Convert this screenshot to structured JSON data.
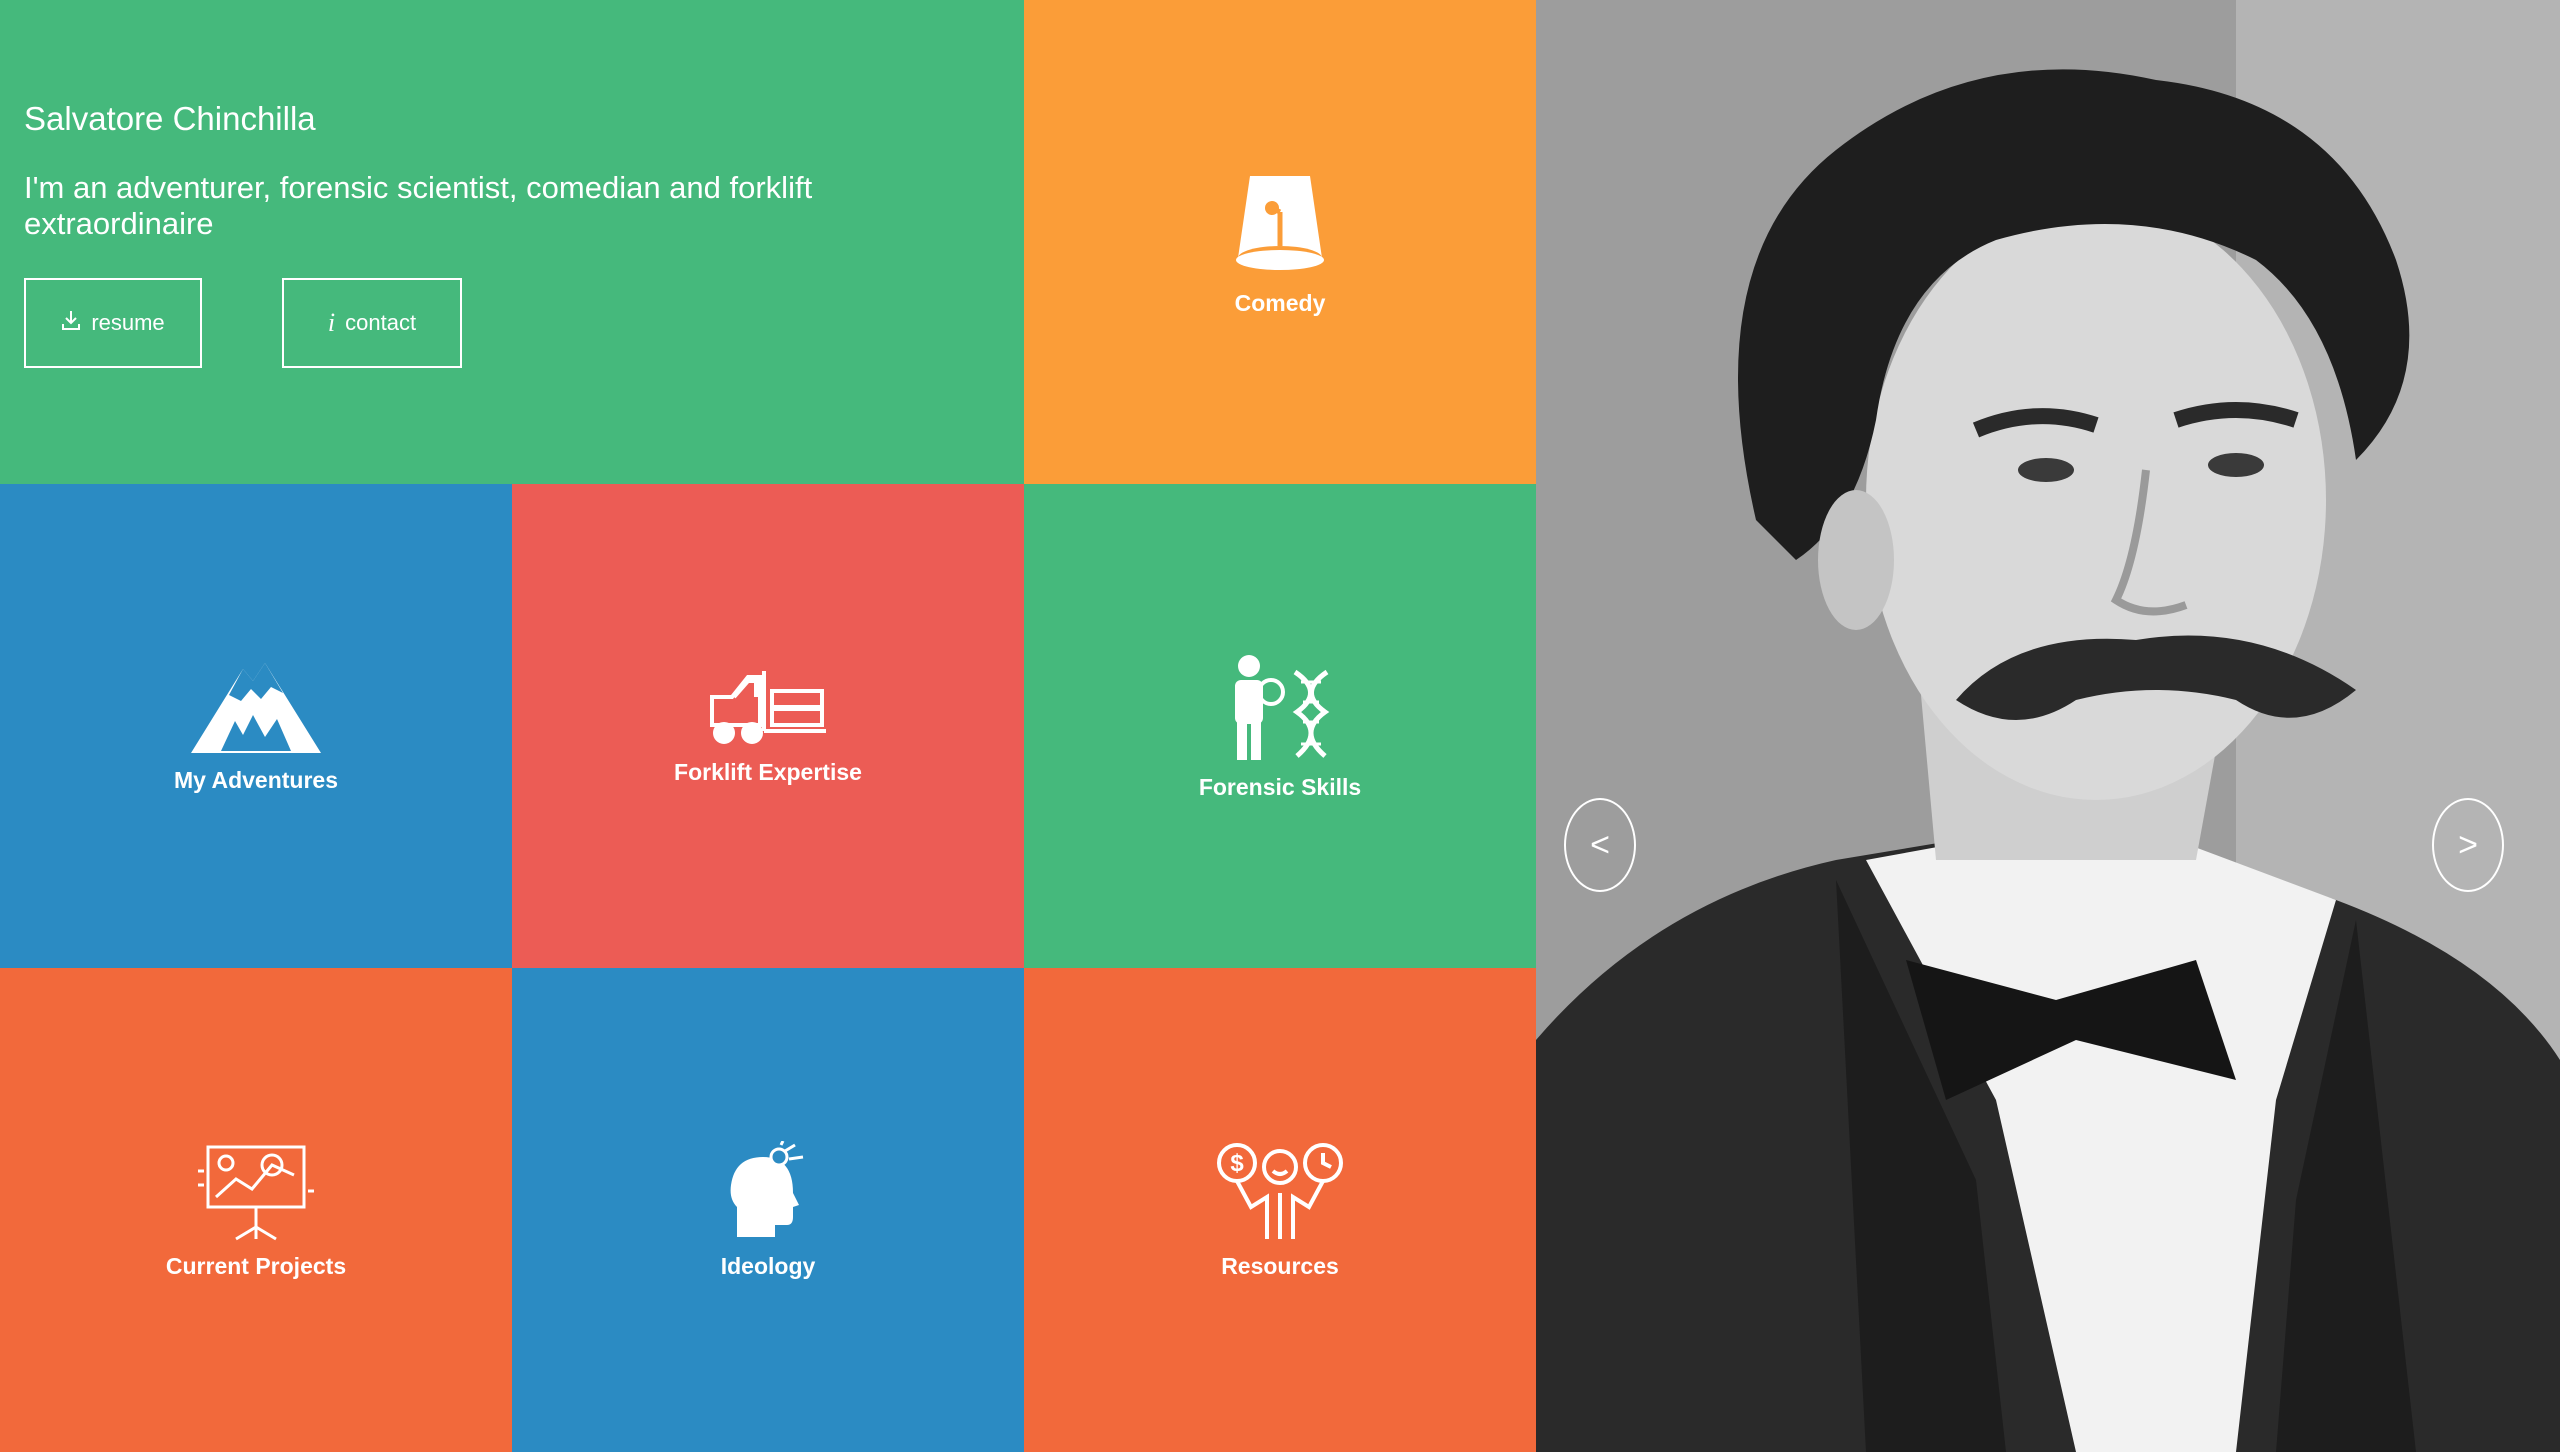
{
  "profile": {
    "name": "Salvatore Chinchilla",
    "tagline": "I'm an adventurer, forensic scientist, comedian and forklift extraordinaire"
  },
  "buttons": {
    "resume": {
      "label": "resume",
      "icon": "download-icon"
    },
    "contact": {
      "label": "contact",
      "icon": "info-icon"
    }
  },
  "tiles": [
    {
      "label": "Comedy",
      "icon": "microphone-icon",
      "color": "#fb9d38"
    },
    {
      "label": "My Adventures",
      "icon": "mountain-icon",
      "color": "#2b8bc3"
    },
    {
      "label": "Forklift Expertise",
      "icon": "forklift-icon",
      "color": "#ec5c55"
    },
    {
      "label": "Forensic Skills",
      "icon": "forensic-dna-icon",
      "color": "#45b97c"
    },
    {
      "label": "Current Projects",
      "icon": "presentation-board-icon",
      "color": "#f2693b"
    },
    {
      "label": "Ideology",
      "icon": "head-idea-icon",
      "color": "#2b8bc3"
    },
    {
      "label": "Resources",
      "icon": "resources-people-icon",
      "color": "#f2693b"
    }
  ],
  "carousel": {
    "prev_label": "<",
    "next_label": ">",
    "image": "portrait-photo"
  },
  "colors": {
    "green": "#45b97c",
    "orange": "#fb9d38",
    "blue": "#2b8bc3",
    "red": "#ec5c55",
    "orange_red": "#f2693b"
  }
}
